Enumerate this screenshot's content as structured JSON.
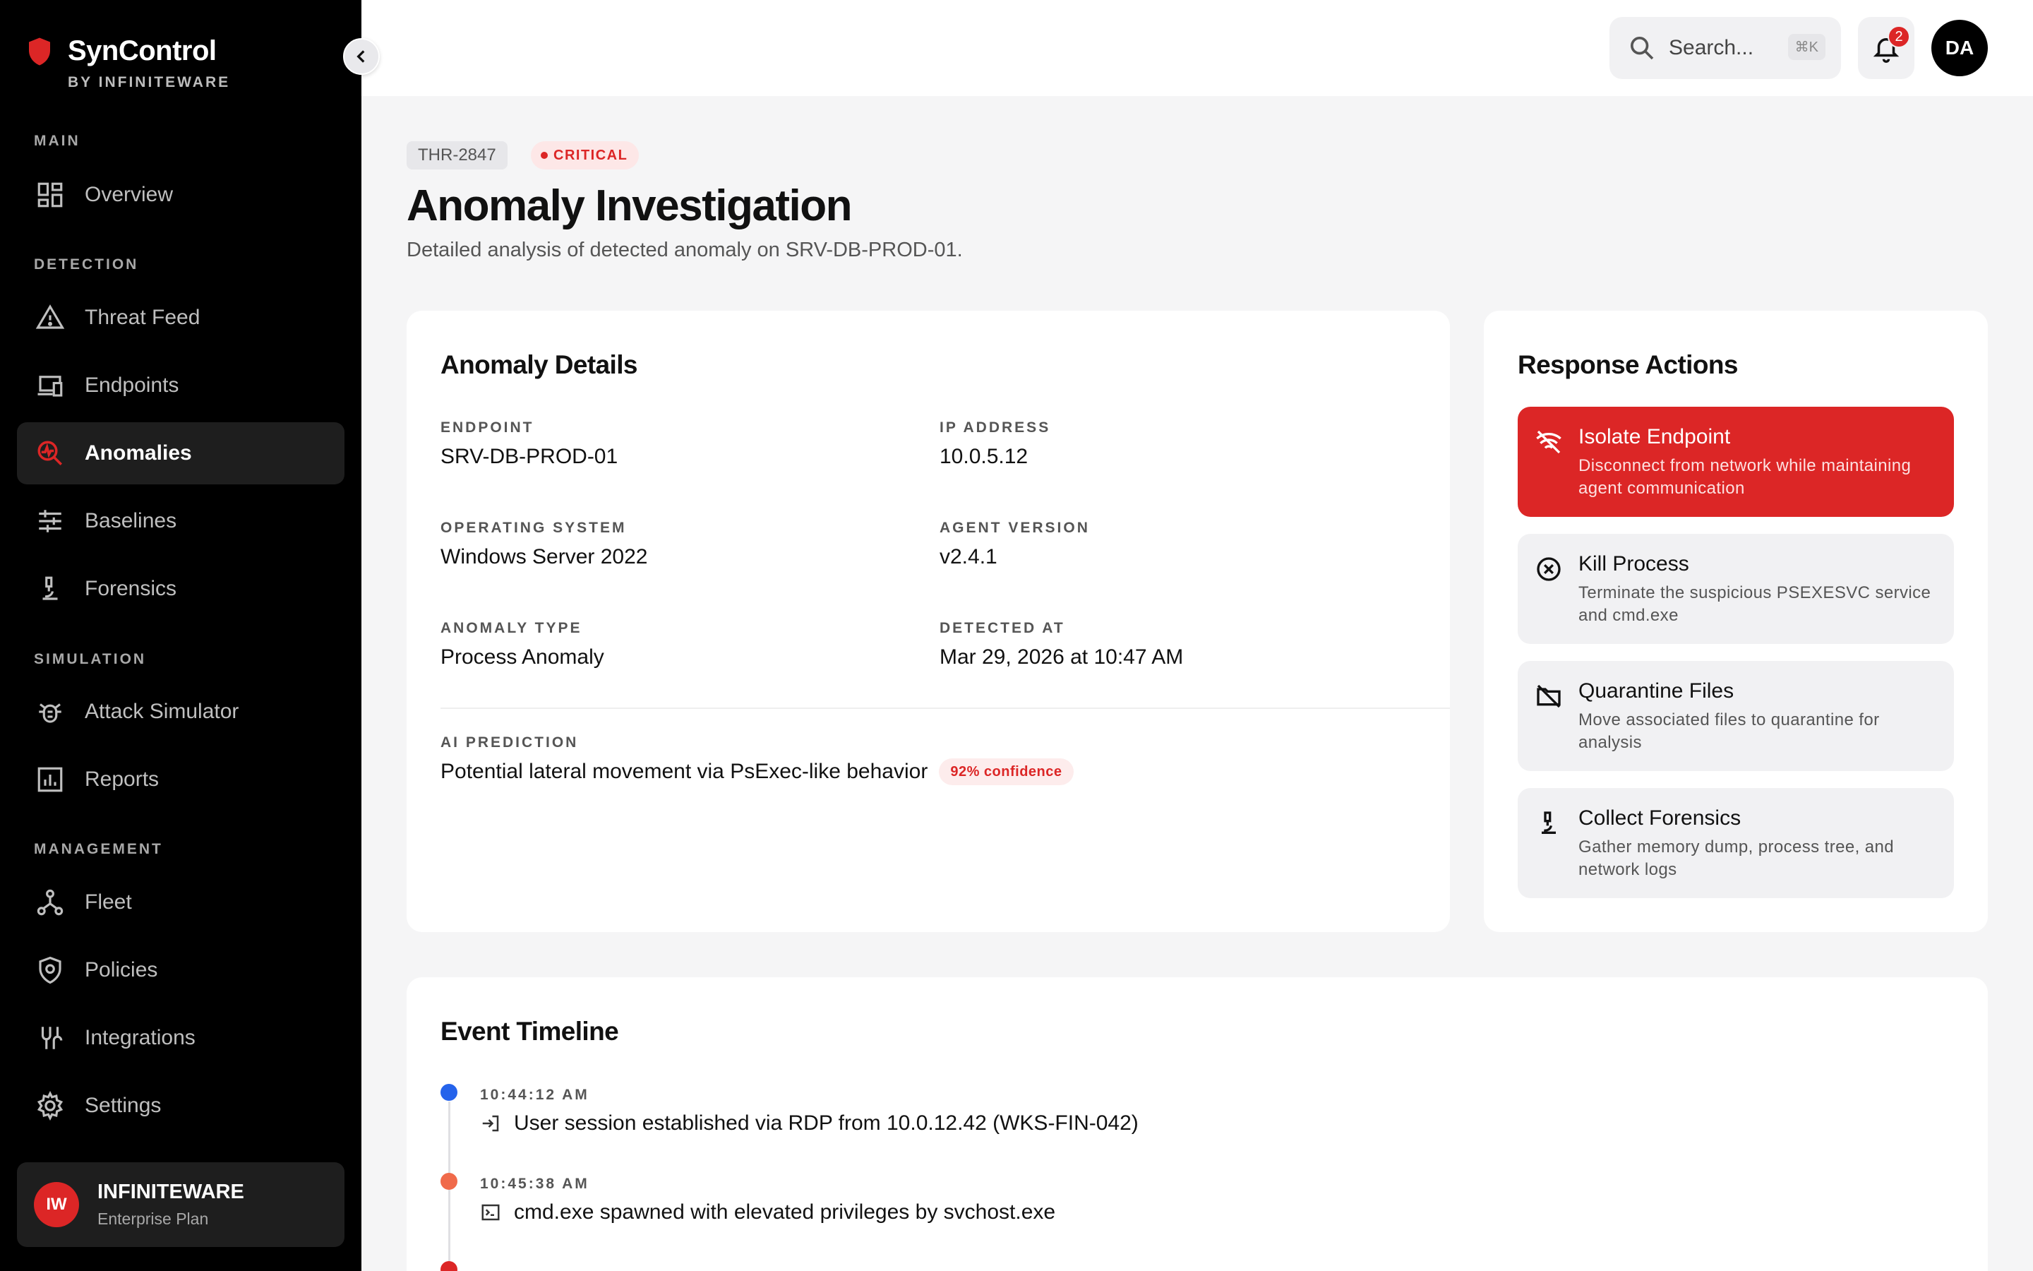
{
  "brand": {
    "name": "SynControl",
    "sub": "BY INFINITEWARE"
  },
  "nav": {
    "main_label": "MAIN",
    "detection_label": "DETECTION",
    "simulation_label": "SIMULATION",
    "management_label": "MANAGEMENT",
    "items": [
      {
        "label": "Overview",
        "icon": "dashboard-icon"
      },
      {
        "label": "Threat Feed",
        "icon": "warning-icon"
      },
      {
        "label": "Endpoints",
        "icon": "devices-icon"
      },
      {
        "label": "Anomalies",
        "icon": "anomaly-icon",
        "active": true
      },
      {
        "label": "Baselines",
        "icon": "sliders-icon"
      },
      {
        "label": "Forensics",
        "icon": "microscope-icon"
      },
      {
        "label": "Attack Simulator",
        "icon": "bug-icon"
      },
      {
        "label": "Reports",
        "icon": "chart-icon"
      },
      {
        "label": "Fleet",
        "icon": "network-icon"
      },
      {
        "label": "Policies",
        "icon": "shield-icon"
      },
      {
        "label": "Integrations",
        "icon": "plug-icon"
      },
      {
        "label": "Settings",
        "icon": "gear-icon"
      }
    ]
  },
  "org": {
    "initials": "IW",
    "name": "INFINITEWARE",
    "plan": "Enterprise Plan"
  },
  "header": {
    "search_placeholder": "Search...",
    "search_shortcut": "⌘K",
    "notification_count": "2",
    "user_initials": "DA"
  },
  "page": {
    "id": "THR-2847",
    "severity": "CRITICAL",
    "title": "Anomaly Investigation",
    "subtitle": "Detailed analysis of detected anomaly on SRV-DB-PROD-01."
  },
  "details": {
    "title": "Anomaly Details",
    "endpoint_label": "ENDPOINT",
    "endpoint": "SRV-DB-PROD-01",
    "ip_label": "IP ADDRESS",
    "ip": "10.0.5.12",
    "os_label": "OPERATING SYSTEM",
    "os": "Windows Server 2022",
    "agent_label": "AGENT VERSION",
    "agent": "v2.4.1",
    "type_label": "ANOMALY TYPE",
    "type": "Process Anomaly",
    "detected_label": "DETECTED AT",
    "detected": "Mar 29, 2026 at 10:47 AM",
    "prediction_label": "AI PREDICTION",
    "prediction": "Potential lateral movement via PsExec-like behavior",
    "confidence": "92% confidence"
  },
  "actions": {
    "title": "Response Actions",
    "items": [
      {
        "title": "Isolate Endpoint",
        "desc": "Disconnect from network while maintaining agent communication",
        "icon": "wifi-off-icon"
      },
      {
        "title": "Kill Process",
        "desc": "Terminate the suspicious PSEXESVC service and cmd.exe",
        "icon": "x-circle-icon"
      },
      {
        "title": "Quarantine Files",
        "desc": "Move associated files to quarantine for analysis",
        "icon": "folder-off-icon"
      },
      {
        "title": "Collect Forensics",
        "desc": "Gather memory dump, process tree, and network logs",
        "icon": "microscope-icon"
      }
    ]
  },
  "timeline": {
    "title": "Event Timeline",
    "events": [
      {
        "time": "10:44:12 AM",
        "text": "User session established via RDP from 10.0.12.42 (WKS-FIN-042)",
        "color": "#2563eb",
        "icon": "login-icon"
      },
      {
        "time": "10:45:38 AM",
        "text": "cmd.exe spawned with elevated privileges by svchost.exe",
        "color": "#f06a4a",
        "icon": "terminal-icon"
      },
      {
        "time": "",
        "text": "",
        "color": "#dc2626",
        "icon": ""
      }
    ]
  },
  "colors": {
    "accent": "#dc2626",
    "sidebar_bg": "#000000",
    "active_bg": "#1e1e1e"
  }
}
